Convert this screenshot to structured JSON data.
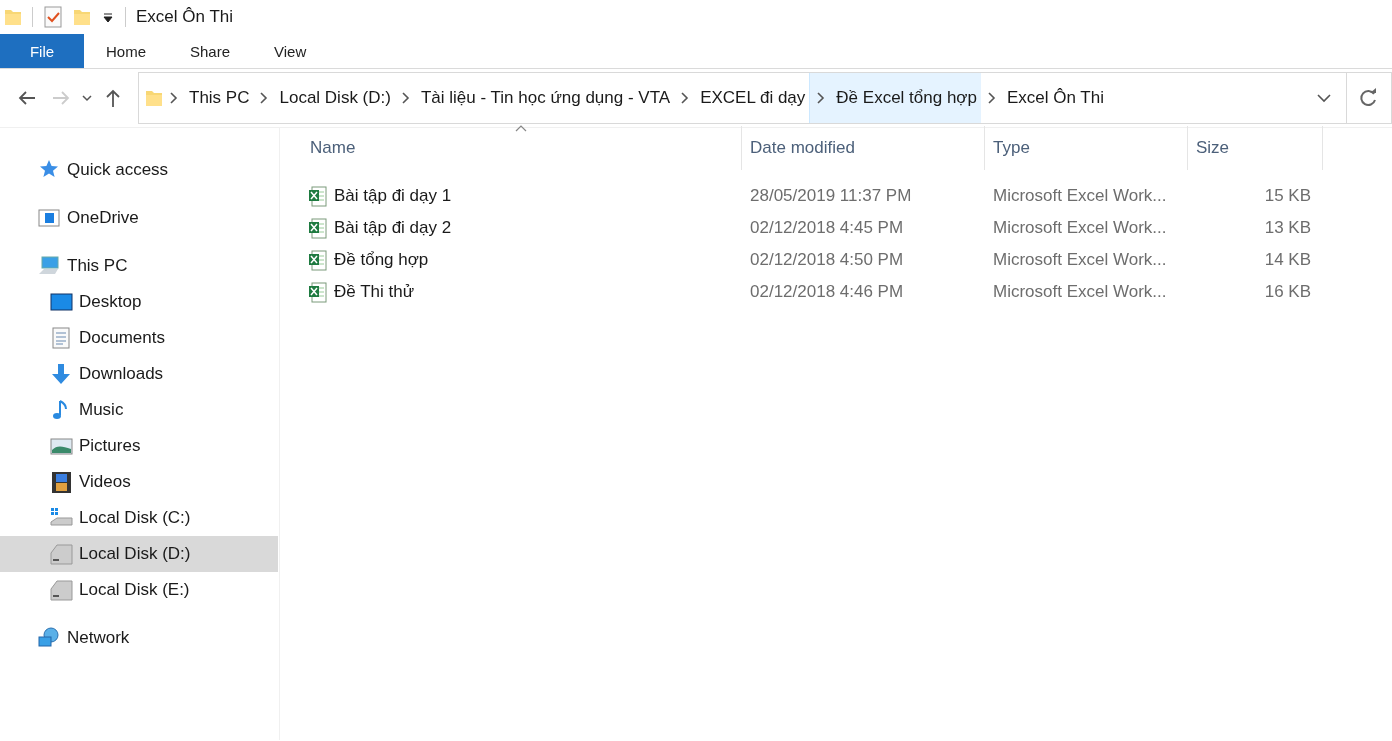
{
  "window": {
    "title": "Excel Ôn Thi"
  },
  "ribbon_tabs": [
    {
      "label": "File",
      "kind": "file",
      "selected": false
    },
    {
      "label": "Home",
      "kind": "tab",
      "selected": false
    },
    {
      "label": "Share",
      "kind": "tab",
      "selected": false
    },
    {
      "label": "View",
      "kind": "tab",
      "selected": false
    }
  ],
  "address_bar": {
    "crumbs": [
      {
        "label": "This PC",
        "highlighted": false
      },
      {
        "label": "Local Disk (D:)",
        "highlighted": false
      },
      {
        "label": "Tài liệu - Tin học ứng dụng - VTA",
        "highlighted": false
      },
      {
        "label": "EXCEL đi dạy",
        "highlighted": false
      },
      {
        "label": "Đề Excel tổng hợp",
        "highlighted": true
      },
      {
        "label": "Excel Ôn Thi",
        "highlighted": false
      }
    ]
  },
  "sidebar": {
    "items": [
      {
        "label": "Quick access",
        "kind": "star",
        "selected": false
      },
      {
        "label": "OneDrive",
        "kind": "cloud",
        "selected": false
      },
      {
        "label": "This PC",
        "kind": "pc",
        "selected": false,
        "children": [
          {
            "label": "Desktop",
            "kind": "desktop",
            "selected": false
          },
          {
            "label": "Documents",
            "kind": "documents",
            "selected": false
          },
          {
            "label": "Downloads",
            "kind": "downloads",
            "selected": false
          },
          {
            "label": "Music",
            "kind": "music",
            "selected": false
          },
          {
            "label": "Pictures",
            "kind": "pictures",
            "selected": false
          },
          {
            "label": "Videos",
            "kind": "videos",
            "selected": false
          },
          {
            "label": "Local Disk (C:)",
            "kind": "systemdrive",
            "selected": false
          },
          {
            "label": "Local Disk (D:)",
            "kind": "drive",
            "selected": true
          },
          {
            "label": "Local Disk (E:)",
            "kind": "drive",
            "selected": false
          }
        ]
      },
      {
        "label": "Network",
        "kind": "network",
        "selected": false
      }
    ]
  },
  "table": {
    "columns": [
      "Name",
      "Date modified",
      "Type",
      "Size"
    ],
    "rows": [
      {
        "name": "Bài tập đi dạy 1",
        "date": "28/05/2019 11:37 PM",
        "type": "Microsoft Excel Work...",
        "size": "15 KB"
      },
      {
        "name": "Bài tập đi dạy 2",
        "date": "02/12/2018 4:45 PM",
        "type": "Microsoft Excel Work...",
        "size": "13 KB"
      },
      {
        "name": "Đề tổng hợp",
        "date": "02/12/2018 4:50 PM",
        "type": "Microsoft Excel Work...",
        "size": "14 KB"
      },
      {
        "name": "Đề Thi thử",
        "date": "02/12/2018 4:46 PM",
        "type": "Microsoft Excel Work...",
        "size": "16 KB"
      }
    ]
  }
}
